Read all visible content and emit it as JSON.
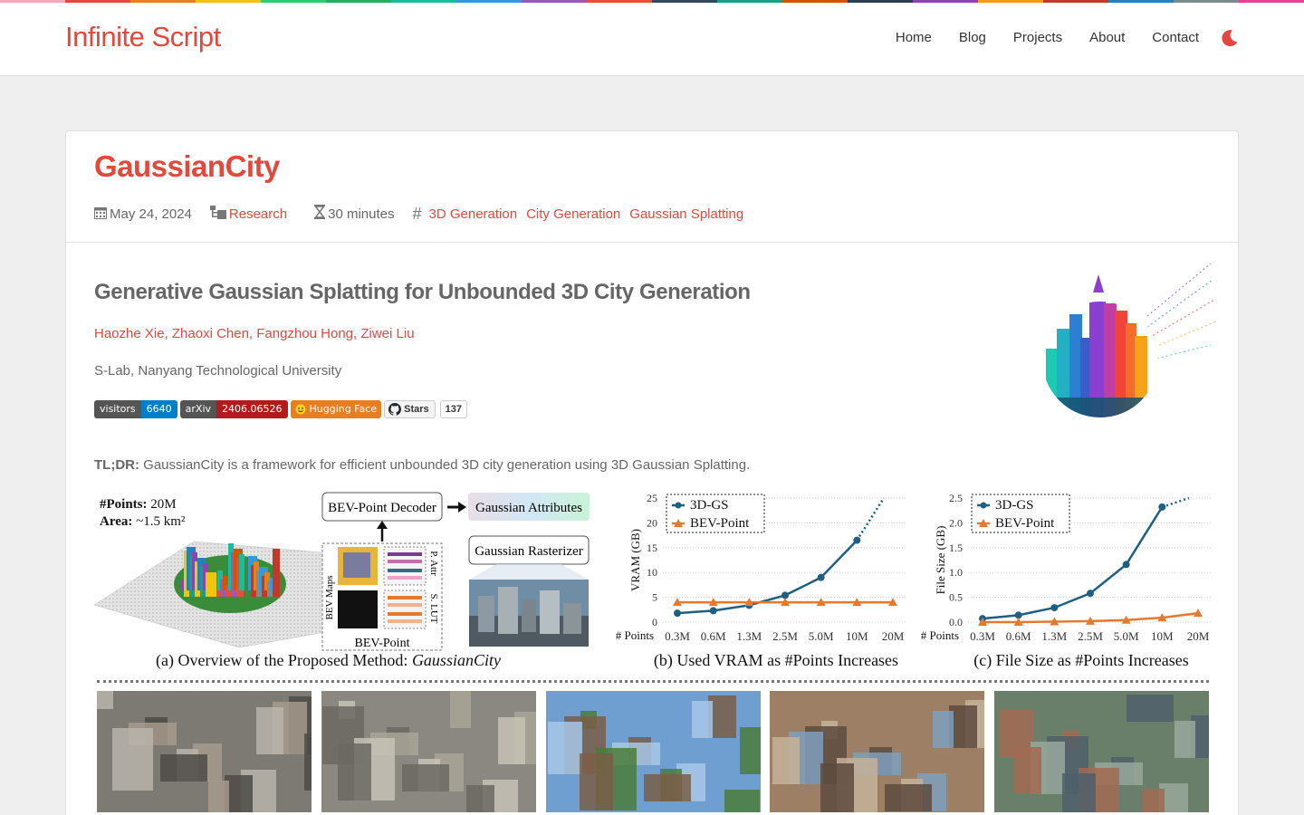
{
  "colors": {
    "accent": "#e2483d",
    "rainbow": [
      "#f0abb6",
      "#e2483d",
      "#e67e22",
      "#f1c40f",
      "#2ecc71",
      "#27ae60",
      "#1abc9c",
      "#3498db",
      "#9b59b6",
      "#e74c3c",
      "#34495e",
      "#16a085",
      "#d35400",
      "#2c3e50",
      "#8e44ad",
      "#f39c12",
      "#c0392b",
      "#2980b9",
      "#7f8c8d",
      "#e84393"
    ]
  },
  "site": {
    "brand": "Infinite Script"
  },
  "nav": {
    "home": "Home",
    "blog": "Blog",
    "projects": "Projects",
    "about": "About",
    "contact": "Contact",
    "theme_icon": "moon-icon"
  },
  "post": {
    "title": "GaussianCity",
    "date": "May 24, 2024",
    "category": "Research",
    "reading_time": "30 minutes",
    "tags": [
      "3D Generation",
      "City Generation",
      "Gaussian Splatting"
    ]
  },
  "paper": {
    "title": "Generative Gaussian Splatting for Unbounded 3D City Generation",
    "authors": "Haozhe Xie, Zhaoxi Chen, Fangzhou Hong, Ziwei Liu",
    "affiliation": "S-Lab, Nanyang Technological University",
    "badges": {
      "visitors_label": "visitors",
      "visitors_value": "6640",
      "arxiv_label": "arXiv",
      "arxiv_value": "2406.06526",
      "hf_label": "Hugging Face",
      "stars_label": "Stars",
      "stars_value": "137"
    },
    "tldr_label": "TL;DR:",
    "tldr_text": " GaussianCity is a framework for efficient unbounded 3D city generation using 3D Gaussian Splatting."
  },
  "figure": {
    "overview": {
      "points_label": "#Points:",
      "points_value": "20M",
      "area_label": "Area:",
      "area_value": "~1.5 km²",
      "decoder": "BEV-Point Decoder",
      "attributes": "Gaussian Attributes",
      "rasterizer": "Gaussian Rasterizer",
      "bev_maps": "BEV Maps",
      "p_attr": "P. Attr",
      "s_lut": "S. LUT",
      "bev_point": "BEV-Point",
      "caption_prefix": "(a) Overview of the Proposed Method: ",
      "caption_method": "GaussianCity"
    }
  },
  "chart_data": [
    {
      "type": "line",
      "title": "(b) Used VRAM as #Points Increases",
      "xlabel": "# Points",
      "ylabel": "VRAM (GB)",
      "categories": [
        "0.3M",
        "0.6M",
        "1.3M",
        "2.5M",
        "5.0M",
        "10M",
        "20M"
      ],
      "ylim": [
        0,
        25
      ],
      "yticks": [
        0,
        5,
        10,
        15,
        20,
        25
      ],
      "grid": true,
      "legend_position": "top-left",
      "series": [
        {
          "name": "3D-GS",
          "color": "#1f5f82",
          "marker": "circle",
          "values": [
            1.8,
            2.3,
            3.4,
            5.4,
            9.0,
            16.5,
            null
          ],
          "extrapolated_to": 25
        },
        {
          "name": "BEV-Point",
          "color": "#e57a2f",
          "marker": "triangle",
          "values": [
            4.0,
            4.0,
            4.0,
            4.0,
            4.0,
            4.0,
            4.0
          ]
        }
      ]
    },
    {
      "type": "line",
      "title": "(c) File Size as #Points Increases",
      "xlabel": "# Points",
      "ylabel": "File Size (GB)",
      "categories": [
        "0.3M",
        "0.6M",
        "1.3M",
        "2.5M",
        "5.0M",
        "10M",
        "20M"
      ],
      "ylim": [
        0,
        2.5
      ],
      "yticks": [
        "0.0",
        "0.5",
        "1.0",
        "1.5",
        "2.0",
        "2.5"
      ],
      "grid": true,
      "legend_position": "top-left",
      "series": [
        {
          "name": "3D-GS",
          "color": "#1f5f82",
          "marker": "circle",
          "values": [
            0.07,
            0.14,
            0.29,
            0.58,
            1.16,
            2.32,
            null
          ],
          "extrapolated_to": 2.5
        },
        {
          "name": "BEV-Point",
          "color": "#e57a2f",
          "marker": "triangle",
          "values": [
            0.0,
            0.0,
            0.01,
            0.02,
            0.04,
            0.09,
            0.18
          ]
        }
      ]
    }
  ],
  "photos": [
    {
      "name": "city-render-1",
      "palette": [
        "#7d7a74",
        "#b9b4aa",
        "#4e4b47",
        "#a59a8c"
      ]
    },
    {
      "name": "city-render-2",
      "palette": [
        "#8a8880",
        "#c7c2b6",
        "#6b6963",
        "#a8a498"
      ]
    },
    {
      "name": "city-render-3",
      "palette": [
        "#6f9ed0",
        "#4a7c3a",
        "#7a5e48",
        "#a8c7e8"
      ]
    },
    {
      "name": "city-render-4",
      "palette": [
        "#9c7f65",
        "#c6b19a",
        "#5d4b3e",
        "#7fa0bd"
      ]
    },
    {
      "name": "city-render-5",
      "palette": [
        "#6a7f6a",
        "#a26a52",
        "#4f5f6b",
        "#98a89b"
      ]
    }
  ]
}
